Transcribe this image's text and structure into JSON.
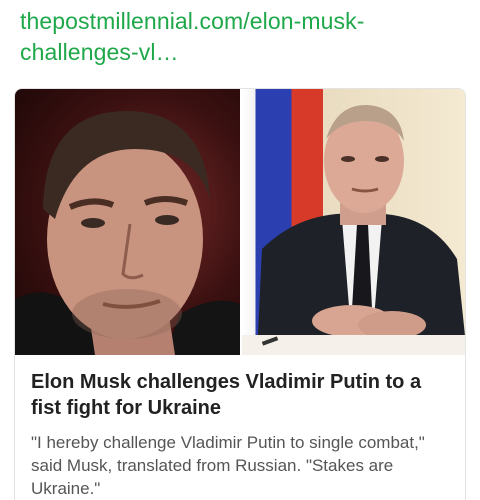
{
  "link": {
    "url_text": "thepostmillennial.com/elon-musk-challenges-vl…"
  },
  "card": {
    "images": [
      {
        "name": "elon-musk-photo"
      },
      {
        "name": "vladimir-putin-photo"
      }
    ],
    "title": "Elon Musk challenges Vladimir Putin to a fist fight for Ukraine",
    "snippet": "\"I hereby challenge Vladimir Putin to single combat,\" said Musk, translated from Russian. \"Stakes are Ukraine.\""
  },
  "colors": {
    "link": "#1ea84a",
    "title": "#222222",
    "snippet": "#555555"
  }
}
